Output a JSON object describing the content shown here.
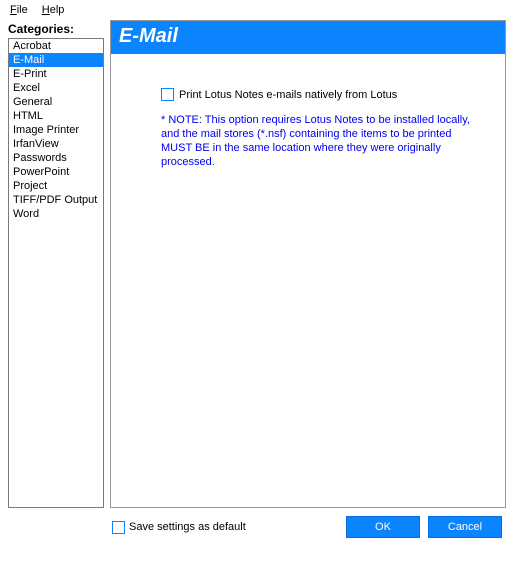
{
  "menu": {
    "file": "File",
    "help": "Help"
  },
  "sidebar": {
    "label": "Categories:",
    "items": [
      "Acrobat",
      "E-Mail",
      "E-Print",
      "Excel",
      "General",
      "HTML",
      "Image Printer",
      "IrfanView",
      "Passwords",
      "PowerPoint",
      "Project",
      "TIFF/PDF Output",
      "Word"
    ],
    "selected_index": 1
  },
  "banner": {
    "title": "E-Mail"
  },
  "option": {
    "checkbox_label": "Print Lotus Notes e-mails natively from Lotus",
    "checked": false,
    "note": "* NOTE:  This option requires Lotus Notes to be installed locally, and the mail stores (*.nsf) containing the items to be printed MUST BE in the same location where they were originally processed."
  },
  "footer": {
    "save_label": "Save settings as default",
    "save_checked": false,
    "ok": "OK",
    "cancel": "Cancel"
  }
}
